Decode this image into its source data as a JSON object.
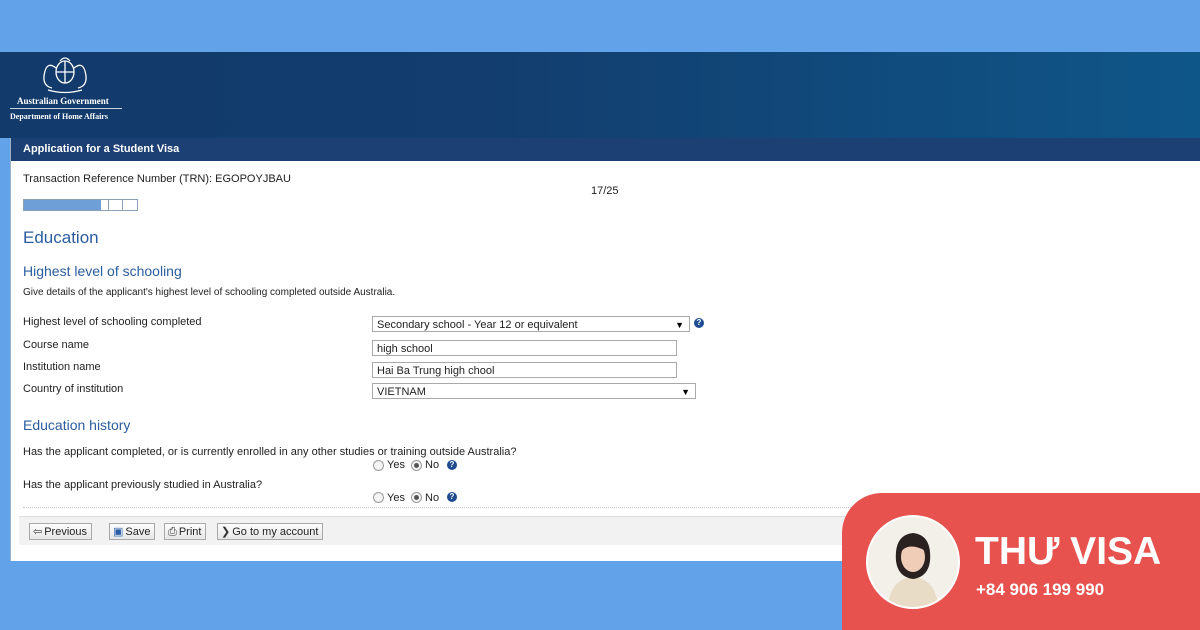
{
  "header": {
    "gov_name": "Australian Government",
    "department": "Department of Home Affairs"
  },
  "app": {
    "title": "Application for a Student Visa",
    "trn": "Transaction Reference Number (TRN): EGOPOYJBAU",
    "page_counter": "17/25",
    "progress": 0.68
  },
  "section": {
    "heading": "Education",
    "schooling_heading": "Highest level of schooling",
    "schooling_desc": "Give details of the applicant's highest level of schooling completed outside Australia.",
    "fields": {
      "level_label": "Highest level of schooling completed",
      "level_value": "Secondary school - Year 12 or equivalent",
      "course_label": "Course name",
      "course_value": "high school",
      "institution_label": "Institution name",
      "institution_value": "Hai Ba Trung high chool",
      "country_label": "Country of institution",
      "country_value": "VIETNAM"
    },
    "history_heading": "Education history",
    "q1": "Has the applicant completed, or is currently enrolled in any other studies or training outside Australia?",
    "q2": "Has the applicant previously studied in Australia?",
    "yes": "Yes",
    "no": "No"
  },
  "footer": {
    "previous": "Previous",
    "save": "Save",
    "print": "Print",
    "account": "Go to my account"
  },
  "icons": {
    "help": "help-icon",
    "previous": "arrow-left-icon",
    "save": "floppy-disk-icon",
    "print": "printer-icon",
    "account": "chevron-right-icon"
  },
  "brand": {
    "name": "THƯ VISA",
    "phone": "+84 906 199 990",
    "color": "#e8524e"
  }
}
